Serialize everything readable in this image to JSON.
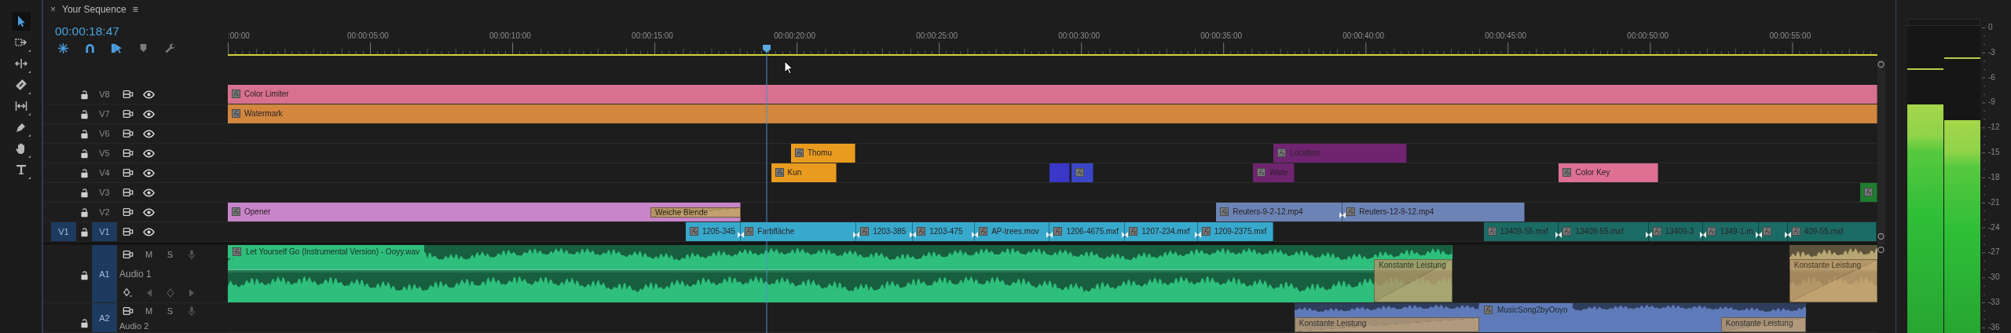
{
  "window": {
    "close_glyph": "×",
    "title": "Your Sequence",
    "menu_glyph": "≡"
  },
  "timecode": "00:00:18:47",
  "tools": [
    {
      "kind": "selection",
      "selected": true
    },
    {
      "kind": "track_select",
      "selected": false
    },
    {
      "kind": "ripple",
      "selected": false
    },
    {
      "kind": "razor",
      "selected": false
    },
    {
      "kind": "slip",
      "selected": false
    },
    {
      "kind": "pen",
      "selected": false
    },
    {
      "kind": "hand",
      "selected": false
    },
    {
      "kind": "type",
      "selected": false
    }
  ],
  "timeline_options": [
    {
      "kind": "nest",
      "on": true
    },
    {
      "kind": "snap",
      "on": true
    },
    {
      "kind": "linked",
      "on": true
    },
    {
      "kind": "marker",
      "on": false
    },
    {
      "kind": "settings",
      "on": false
    }
  ],
  "ruler": {
    "labels": [
      ":00:00",
      "00:00:05:00",
      "00:00:10:00",
      "00:00:15:00",
      "00:00:20:00",
      "00:00:25:00",
      "00:00:30:00",
      "00:00:35:00",
      "00:00:40:00",
      "00:00:45:00",
      "00:00:50:00",
      "00:00:55:00"
    ]
  },
  "video_tracks": [
    {
      "name": "V8",
      "locked": false,
      "targeted": false,
      "visible": true,
      "clips": [
        {
          "label": "Color Limiter",
          "color": "#d8708f",
          "fx": true,
          "edit_point": false
        }
      ]
    },
    {
      "name": "V7",
      "locked": false,
      "targeted": false,
      "visible": true,
      "clips": [
        {
          "label": "Watermark",
          "color": "#d2863e",
          "fx": true,
          "edit_point": false
        }
      ]
    },
    {
      "name": "V6",
      "locked": false,
      "targeted": false,
      "visible": true
    },
    {
      "name": "V5",
      "locked": false,
      "targeted": false,
      "visible": true,
      "clips": [
        {
          "label": "Thomu",
          "color": "#e89b1e",
          "fx": true,
          "edit_point": false
        },
        {
          "label": "Location",
          "color": "#6f2470",
          "fx": true,
          "edit_point": false
        }
      ]
    },
    {
      "name": "V4",
      "locked": false,
      "targeted": false,
      "visible": true,
      "clips": [
        {
          "label": "Kun",
          "color": "#e89b1e",
          "fx": true,
          "edit_point": false
        },
        {
          "color": "#3a36c8",
          "fx": false,
          "edit_point": false
        },
        {
          "color": "#3a46c6",
          "fx": true,
          "edit_point": false
        },
        {
          "label": "Wate",
          "color": "#6f2470",
          "fx": true,
          "edit_point": false
        },
        {
          "label": "Color Key",
          "color": "#dd7093",
          "fx": true,
          "edit_point": false
        }
      ]
    },
    {
      "name": "V3",
      "locked": false,
      "targeted": false,
      "visible": true,
      "clips": [
        {
          "color": "#1f7d30",
          "fx": true,
          "edit_point": false
        }
      ]
    },
    {
      "name": "V2",
      "locked": false,
      "targeted": false,
      "visible": true,
      "clips": [
        {
          "label": "Opener",
          "color": "#c884c8",
          "fx": true,
          "edit_point": false,
          "transitions": [
            {
              "label": "Weiche Blende"
            }
          ]
        },
        {
          "label": "Reuters-9-2-12.mp4",
          "color": "#6b83b5",
          "fx": true,
          "edit_point": false
        },
        {
          "label": "Reuters-12-9-12.mp4",
          "color": "#6b83b5",
          "fx": true,
          "edit_point": true
        }
      ]
    },
    {
      "name": "V1",
      "locked": false,
      "targeted": true,
      "visible": true,
      "source": "V1",
      "clips": [
        {
          "label": "1205-345",
          "color": "#37a9cc",
          "fx": true,
          "edit_point": false
        },
        {
          "label": "Farbfläche",
          "color": "#37a9cc",
          "fx": true,
          "edit_point": true
        },
        {
          "label": "1203-385",
          "color": "#37a9cc",
          "fx": true,
          "edit_point": true
        },
        {
          "label": "1203-475",
          "color": "#37a9cc",
          "fx": true,
          "edit_point": true
        },
        {
          "label": "AP-trees.mov",
          "color": "#37a9cc",
          "fx": true,
          "edit_point": true
        },
        {
          "label": "1206-4675.mxf",
          "color": "#37a9cc",
          "fx": true,
          "edit_point": true
        },
        {
          "label": "1207-234.mxf",
          "color": "#37a9cc",
          "fx": true,
          "edit_point": true
        },
        {
          "label": "1209-2375.mxf",
          "color": "#37a9cc",
          "fx": true,
          "edit_point": true
        },
        {
          "label": "13409-55.mxf",
          "color": "#1b6b65",
          "fx": true,
          "edit_point": false
        },
        {
          "label": "13409-55.mxf",
          "color": "#1b6b65",
          "fx": true,
          "edit_point": true
        },
        {
          "label": "13409-3",
          "color": "#1b6b65",
          "fx": true,
          "edit_point": true
        },
        {
          "label": "1349-1.m",
          "color": "#1b6b65",
          "fx": true,
          "edit_point": true
        },
        {
          "color": "#1b6b65",
          "fx": true,
          "edit_point": true
        },
        {
          "label": "409-55.mxf",
          "color": "#1b6b65",
          "fx": true,
          "edit_point": true
        }
      ]
    }
  ],
  "audio_tracks": [
    {
      "name": "A1",
      "label": "Audio 1",
      "mute": "M",
      "solo": "S",
      "locked": false,
      "targeted": true,
      "keyframes": true,
      "clips": [
        {
          "label": "Let Yourself Go (Instrumental Version) - Ooyy.wav",
          "color": "#2ebf7c",
          "fx": true,
          "transitions": [
            {
              "label": "Konstante Leistung"
            }
          ]
        },
        {
          "color": "#b9a675",
          "fx": false,
          "transitions": [
            {
              "label": "Konstante Leistung"
            }
          ]
        }
      ]
    },
    {
      "name": "A2",
      "label": "Audio 2",
      "mute": "M",
      "solo": "S",
      "locked": false,
      "targeted": true,
      "keyframes": false,
      "clips": [
        {
          "color": "#5f7ab8",
          "fx": false,
          "transitions": [
            {
              "label": "Konstante Leistung"
            }
          ]
        },
        {
          "label": "MusicSong2byOoyo",
          "color": "#5f7ab8",
          "fx": true,
          "transitions": [
            {
              "label": "Konstante Leistung"
            }
          ]
        }
      ]
    }
  ],
  "meter": {
    "scale": [
      "0",
      "-3",
      "-6",
      "-9",
      "-12",
      "-15",
      "-18",
      "-21",
      "-24",
      "-27",
      "-30",
      "-33",
      "-36"
    ],
    "channels": [
      {
        "level": 0.744,
        "peak": {
          "level": 0.857
        }
      },
      {
        "level": 0.693,
        "peak": {
          "level": 0.893
        }
      }
    ]
  }
}
